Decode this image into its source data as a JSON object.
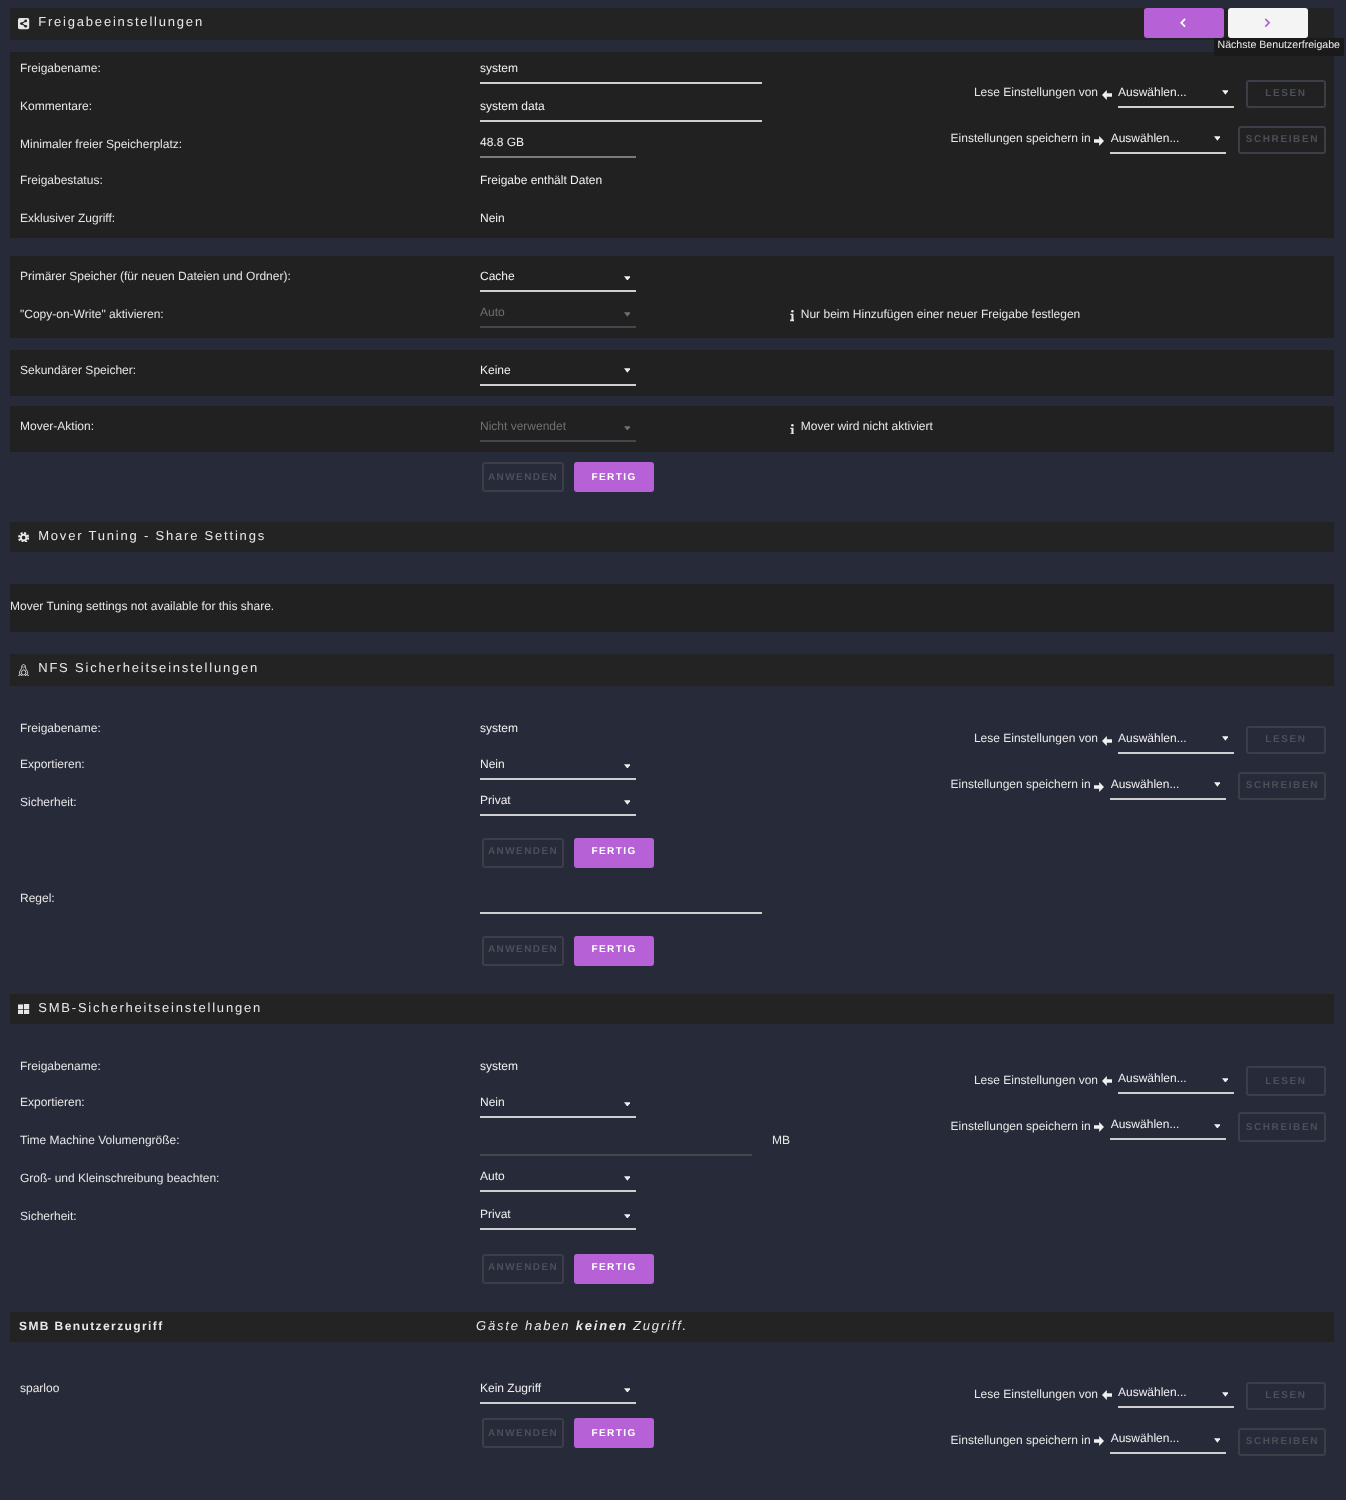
{
  "share_settings": {
    "title": "Freigabeeinstellungen",
    "nav_buttons": [
      {
        "kind": "previous",
        "hovered": false
      },
      {
        "kind": "next",
        "hovered": true
      }
    ],
    "tooltip": "Nächste Benutzerfreigabe",
    "clone": {
      "read_label": "Lese Einstellungen von",
      "read_select": "Auswählen...",
      "read_button": {
        "label": "LESEN",
        "disabled": true
      },
      "write_label": "Einstellungen speichern in",
      "write_select": "Auswählen...",
      "write_button": {
        "label": "SCHREIBEN",
        "disabled": true
      }
    },
    "groups": [
      {
        "rows": [
          {
            "label": "Freigabename:",
            "kind": "input",
            "value": "system",
            "disabled": false
          },
          {
            "label": "Kommentare:",
            "kind": "input",
            "value": "system data",
            "disabled": false
          },
          {
            "label": "Minimaler freier Speicherplatz:",
            "kind": "number",
            "value": "48.8 GB",
            "disabled": false
          },
          {
            "label": "Freigabestatus:",
            "kind": "text",
            "value": "Freigabe enthält Daten",
            "disabled": false
          },
          {
            "label": "Exklusiver Zugriff:",
            "kind": "text",
            "value": "Nein",
            "disabled": false
          }
        ]
      },
      {
        "rows": [
          {
            "label": "Primärer Speicher (für neuen Dateien und Ordner):",
            "kind": "select",
            "value": "Cache",
            "disabled": false
          },
          {
            "label": "\"Copy-on-Write\" aktivieren:",
            "kind": "select",
            "value": "Auto",
            "disabled": true,
            "note": "Nur beim Hinzufügen einer neuer Freigabe festlegen"
          }
        ]
      },
      {
        "rows": [
          {
            "label": "Sekundärer Speicher:",
            "kind": "select",
            "value": "Keine",
            "disabled": false
          }
        ]
      },
      {
        "rows": [
          {
            "label": "Mover-Aktion:",
            "kind": "select",
            "value": "Nicht verwendet",
            "disabled": true,
            "note": "Mover wird nicht aktiviert"
          }
        ]
      }
    ],
    "actions": [
      {
        "kind": "apply",
        "label": "ANWENDEN",
        "disabled": true
      },
      {
        "kind": "done",
        "label": "FERTIG",
        "disabled": false
      }
    ]
  },
  "mover_tuning": {
    "title": "Mover Tuning - Share Settings",
    "message": "Mover Tuning settings not available for this share."
  },
  "nfs": {
    "title": "NFS Sicherheitseinstellungen",
    "clone": {
      "read_label": "Lese Einstellungen von",
      "read_select": "Auswählen...",
      "read_button": {
        "label": "LESEN",
        "disabled": true
      },
      "write_label": "Einstellungen speichern in",
      "write_select": "Auswählen...",
      "write_button": {
        "label": "SCHREIBEN",
        "disabled": true
      }
    },
    "blocks": [
      {
        "rows": [
          {
            "label": "Freigabename:",
            "kind": "text",
            "value": "system",
            "disabled": false
          },
          {
            "label": "Exportieren:",
            "kind": "select",
            "value": "Nein",
            "disabled": false
          },
          {
            "label": "Sicherheit:",
            "kind": "select",
            "value": "Privat",
            "disabled": false
          }
        ],
        "actions": [
          {
            "kind": "apply",
            "label": "ANWENDEN",
            "disabled": true
          },
          {
            "kind": "done",
            "label": "FERTIG",
            "disabled": false
          }
        ]
      },
      {
        "rows": [
          {
            "label": "Regel:",
            "kind": "input",
            "disabled": false
          }
        ],
        "actions": [
          {
            "kind": "apply",
            "label": "ANWENDEN",
            "disabled": true
          },
          {
            "kind": "done",
            "label": "FERTIG",
            "disabled": false
          }
        ]
      }
    ]
  },
  "smb": {
    "title": "SMB-Sicherheitseinstellungen",
    "clone": {
      "read_label": "Lese Einstellungen von",
      "read_select": "Auswählen...",
      "read_button": {
        "label": "LESEN",
        "disabled": true
      },
      "write_label": "Einstellungen speichern in",
      "write_select": "Auswählen...",
      "write_button": {
        "label": "SCHREIBEN",
        "disabled": true
      }
    },
    "rows": [
      {
        "label": "Freigabename:",
        "kind": "text",
        "value": "system",
        "disabled": false
      },
      {
        "label": "Exportieren:",
        "kind": "select",
        "value": "Nein",
        "disabled": false
      },
      {
        "label": "Time Machine Volumengröße:",
        "kind": "input",
        "disabled": true,
        "unit": "MB"
      },
      {
        "label": "Groß- und Kleinschreibung beachten:",
        "kind": "select",
        "value": "Auto",
        "disabled": false
      },
      {
        "label": "Sicherheit:",
        "kind": "select",
        "value": "Privat",
        "disabled": false
      }
    ],
    "actions": [
      {
        "kind": "apply",
        "label": "ANWENDEN",
        "disabled": true
      },
      {
        "kind": "done",
        "label": "FERTIG",
        "disabled": false
      }
    ]
  },
  "smb_users": {
    "title": "SMB Benutzerzugriff",
    "note": "Gäste haben **keinen** Zugriff.",
    "clone": {
      "read_label": "Lese Einstellungen von",
      "read_select": "Auswählen...",
      "read_button": {
        "label": "LESEN",
        "disabled": true
      },
      "write_label": "Einstellungen speichern in",
      "write_select": "Auswählen...",
      "write_button": {
        "label": "SCHREIBEN",
        "disabled": true
      }
    },
    "rows": [
      {
        "label": "sparloo",
        "kind": "select",
        "value": "Kein Zugriff",
        "disabled": false
      }
    ],
    "actions": [
      {
        "kind": "apply",
        "label": "ANWENDEN",
        "disabled": true
      },
      {
        "kind": "done",
        "label": "FERTIG",
        "disabled": false
      }
    ]
  }
}
